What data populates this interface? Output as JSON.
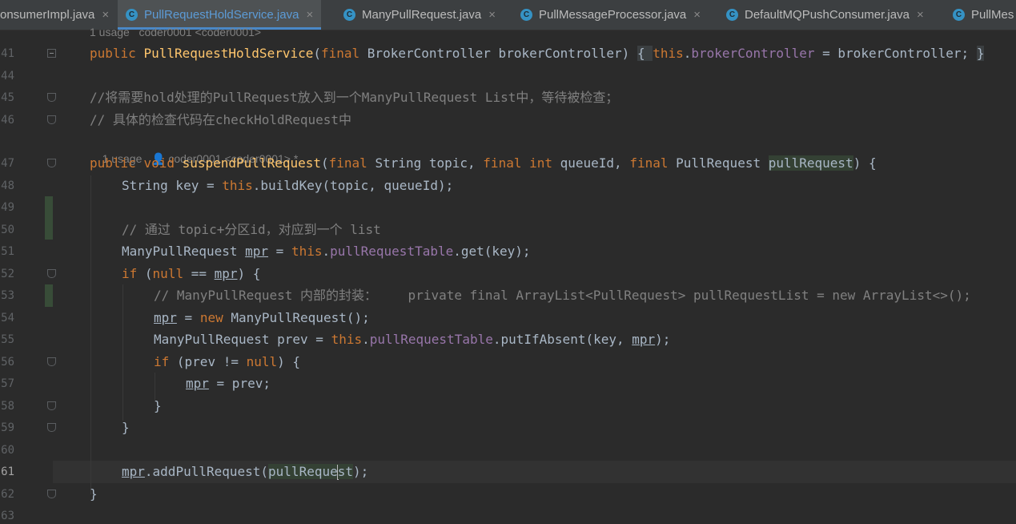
{
  "tabs": [
    {
      "label": "onsumerImpl.java",
      "icon": "",
      "active": false
    },
    {
      "label": "PullRequestHoldService.java",
      "icon": "C",
      "active": true
    },
    {
      "label": "ManyPullRequest.java",
      "icon": "C",
      "active": false
    },
    {
      "label": "PullMessageProcessor.java",
      "icon": "C",
      "active": false
    },
    {
      "label": "DefaultMQPushConsumer.java",
      "icon": "C",
      "active": false
    },
    {
      "label": "PullMes",
      "icon": "C",
      "active": false
    }
  ],
  "tab_close_glyph": "×",
  "line_numbers": [
    "41",
    "44",
    "45",
    "46",
    "47",
    "48",
    "49",
    "50",
    "51",
    "52",
    "53",
    "54",
    "55",
    "56",
    "57",
    "58",
    "59",
    "60",
    "61",
    "62",
    "63"
  ],
  "hints": {
    "top": "1 usage   coder0001 <coder0001>",
    "middle_usage": "1 usage",
    "middle_author": "coder0001 <coder0001> *"
  },
  "code": {
    "l41": [
      "public ",
      "PullRequestHoldService",
      "(",
      "final ",
      "BrokerController brokerController) ",
      "{ ",
      "this",
      ".",
      "brokerController",
      " = brokerController; ",
      "}"
    ],
    "l45": "//将需要hold处理的PullRequest放入到一个ManyPullRequest List中，等待被检查；",
    "l46": "// 具体的检查代码在checkHoldRequest中",
    "l47": [
      "public ",
      "void ",
      "suspendPullRequest",
      "(",
      "final ",
      "String topic, ",
      "final ",
      "int ",
      "queueId, ",
      "final ",
      "PullRequest ",
      "pullRequest",
      ") {"
    ],
    "l48": [
      "String key = ",
      "this",
      ".buildKey(topic, queueId);"
    ],
    "l50": "// 通过 topic+分区id，对应到一个 list",
    "l51": [
      "ManyPullRequest ",
      "mpr",
      " = ",
      "this",
      ".",
      "pullRequestTable",
      ".get(key);"
    ],
    "l52": [
      "if ",
      "(",
      "null",
      " == ",
      "mpr",
      ") {"
    ],
    "l53": "// ManyPullRequest 内部的封装：    private final ArrayList<PullRequest> pullRequestList = new ArrayList<>();",
    "l54": [
      "mpr",
      " = ",
      "new ",
      "ManyPullRequest();"
    ],
    "l55": [
      "ManyPullRequest prev = ",
      "this",
      ".",
      "pullRequestTable",
      ".putIfAbsent(key, ",
      "mpr",
      ");"
    ],
    "l56": [
      "if ",
      "(prev != ",
      "null",
      ") {"
    ],
    "l57": [
      "mpr",
      " = prev;"
    ],
    "l58": "}",
    "l59": "}",
    "l61": [
      "mpr",
      ".addPullRequest(",
      "pullReque",
      "st",
      ");"
    ],
    "l62": "}"
  }
}
